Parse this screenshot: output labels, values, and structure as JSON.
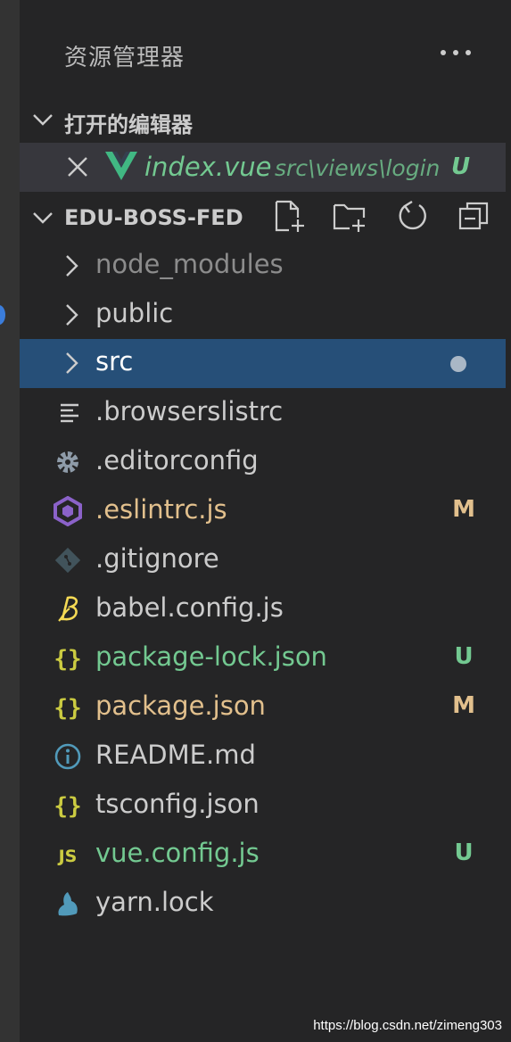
{
  "panel": {
    "title": "资源管理器",
    "more_icon": "ellipsis-icon"
  },
  "open_editors": {
    "label": "打开的编辑器",
    "items": [
      {
        "name": "index.vue",
        "path": "src\\views\\login",
        "status": "U",
        "icon": "vue-icon"
      }
    ]
  },
  "workspace": {
    "label": "EDU-BOSS-FED",
    "toolbar": [
      "new-file-icon",
      "new-folder-icon",
      "refresh-icon",
      "collapse-all-icon"
    ]
  },
  "tree": [
    {
      "name": "node_modules",
      "type": "folder",
      "status": "",
      "git": "ignored"
    },
    {
      "name": "public",
      "type": "folder",
      "status": "",
      "git": "none"
    },
    {
      "name": "src",
      "type": "folder",
      "status": "",
      "git": "dot",
      "selected": true
    },
    {
      "name": ".browserslistrc",
      "type": "file",
      "icon": "text-lines-icon",
      "status": "",
      "git": "none"
    },
    {
      "name": ".editorconfig",
      "type": "file",
      "icon": "gear-icon",
      "status": "",
      "git": "none"
    },
    {
      "name": ".eslintrc.js",
      "type": "file",
      "icon": "eslint-icon",
      "status": "M",
      "git": "modified"
    },
    {
      "name": ".gitignore",
      "type": "file",
      "icon": "git-icon",
      "status": "",
      "git": "none"
    },
    {
      "name": "babel.config.js",
      "type": "file",
      "icon": "babel-icon",
      "status": "",
      "git": "none"
    },
    {
      "name": "package-lock.json",
      "type": "file",
      "icon": "json-braces-icon",
      "status": "U",
      "git": "untracked"
    },
    {
      "name": "package.json",
      "type": "file",
      "icon": "json-braces-icon",
      "status": "M",
      "git": "modified"
    },
    {
      "name": "README.md",
      "type": "file",
      "icon": "info-icon",
      "status": "",
      "git": "none"
    },
    {
      "name": "tsconfig.json",
      "type": "file",
      "icon": "json-braces-icon",
      "status": "",
      "git": "none"
    },
    {
      "name": "vue.config.js",
      "type": "file",
      "icon": "js-icon",
      "status": "U",
      "git": "untracked"
    },
    {
      "name": "yarn.lock",
      "type": "file",
      "icon": "yarn-icon",
      "status": "",
      "git": "none"
    }
  ],
  "colors": {
    "modified": "#e2c08d",
    "untracked": "#73c991",
    "selection": "#264f78",
    "vue_green": "#41b883"
  },
  "watermark": "https://blog.csdn.net/zimeng303"
}
